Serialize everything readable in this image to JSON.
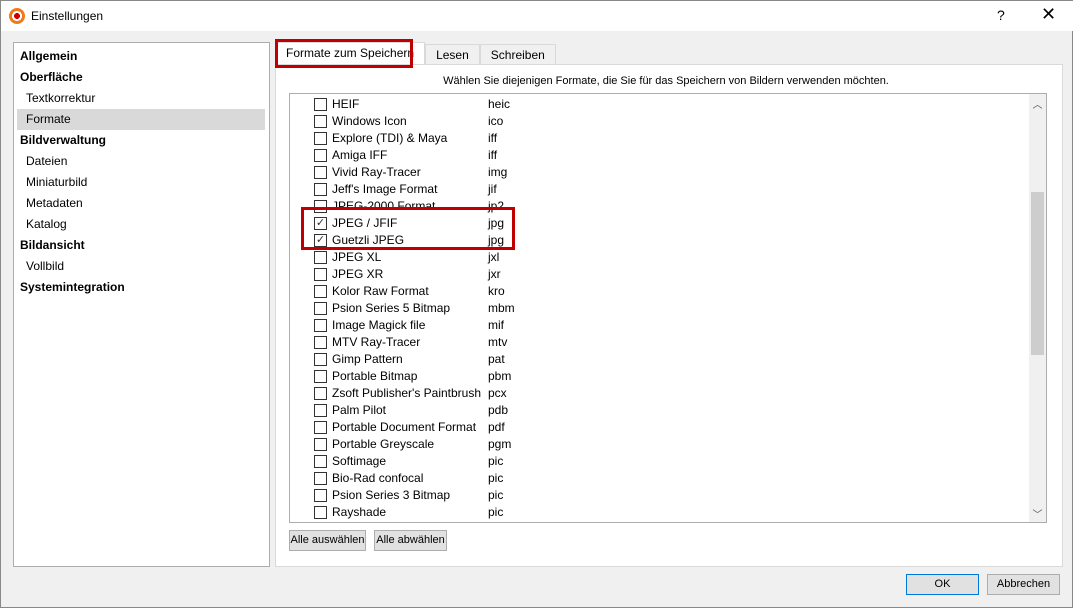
{
  "window": {
    "title": "Einstellungen",
    "help": "?",
    "close": "✕"
  },
  "sidebar": {
    "items": [
      {
        "label": "Allgemein",
        "level": 0
      },
      {
        "label": "Oberfläche",
        "level": 0
      },
      {
        "label": "Textkorrektur",
        "level": 1
      },
      {
        "label": "Formate",
        "level": 1,
        "selected": true
      },
      {
        "label": "Bildverwaltung",
        "level": 0
      },
      {
        "label": "Dateien",
        "level": 1
      },
      {
        "label": "Miniaturbild",
        "level": 1
      },
      {
        "label": "Metadaten",
        "level": 1
      },
      {
        "label": "Katalog",
        "level": 1
      },
      {
        "label": "Bildansicht",
        "level": 0
      },
      {
        "label": "Vollbild",
        "level": 1
      },
      {
        "label": "Systemintegration",
        "level": 0
      }
    ]
  },
  "tabs": [
    {
      "label": "Formate zum Speichern",
      "active": true
    },
    {
      "label": "Lesen"
    },
    {
      "label": "Schreiben"
    }
  ],
  "description": "Wählen Sie diejenigen Formate, die Sie für das Speichern von Bildern verwenden möchten.",
  "formats": [
    {
      "name": "HEIF",
      "ext": "heic",
      "checked": false
    },
    {
      "name": "Windows Icon",
      "ext": "ico",
      "checked": false
    },
    {
      "name": "Explore (TDI) & Maya",
      "ext": "iff",
      "checked": false
    },
    {
      "name": "Amiga IFF",
      "ext": "iff",
      "checked": false
    },
    {
      "name": "Vivid Ray-Tracer",
      "ext": "img",
      "checked": false
    },
    {
      "name": "Jeff's Image Format",
      "ext": "jif",
      "checked": false
    },
    {
      "name": "JPEG-2000 Format",
      "ext": "jp2",
      "checked": false
    },
    {
      "name": "JPEG / JFIF",
      "ext": "jpg",
      "checked": true
    },
    {
      "name": "Guetzli JPEG",
      "ext": "jpg",
      "checked": true
    },
    {
      "name": "JPEG XL",
      "ext": "jxl",
      "checked": false
    },
    {
      "name": "JPEG XR",
      "ext": "jxr",
      "checked": false
    },
    {
      "name": "Kolor Raw Format",
      "ext": "kro",
      "checked": false
    },
    {
      "name": "Psion Series 5 Bitmap",
      "ext": "mbm",
      "checked": false
    },
    {
      "name": "Image Magick file",
      "ext": "mif",
      "checked": false
    },
    {
      "name": "MTV Ray-Tracer",
      "ext": "mtv",
      "checked": false
    },
    {
      "name": "Gimp Pattern",
      "ext": "pat",
      "checked": false
    },
    {
      "name": "Portable Bitmap",
      "ext": "pbm",
      "checked": false
    },
    {
      "name": "Zsoft Publisher's Paintbrush",
      "ext": "pcx",
      "checked": false
    },
    {
      "name": "Palm Pilot",
      "ext": "pdb",
      "checked": false
    },
    {
      "name": "Portable Document Format",
      "ext": "pdf",
      "checked": false
    },
    {
      "name": "Portable Greyscale",
      "ext": "pgm",
      "checked": false
    },
    {
      "name": "Softimage",
      "ext": "pic",
      "checked": false
    },
    {
      "name": "Bio-Rad confocal",
      "ext": "pic",
      "checked": false
    },
    {
      "name": "Psion Series 3 Bitmap",
      "ext": "pic",
      "checked": false
    },
    {
      "name": "Rayshade",
      "ext": "pic",
      "checked": false
    }
  ],
  "buttons": {
    "select_all": "Alle auswählen",
    "deselect_all": "Alle abwählen",
    "ok": "OK",
    "cancel": "Abbrechen"
  },
  "colors": {
    "highlight": "#c00000"
  }
}
